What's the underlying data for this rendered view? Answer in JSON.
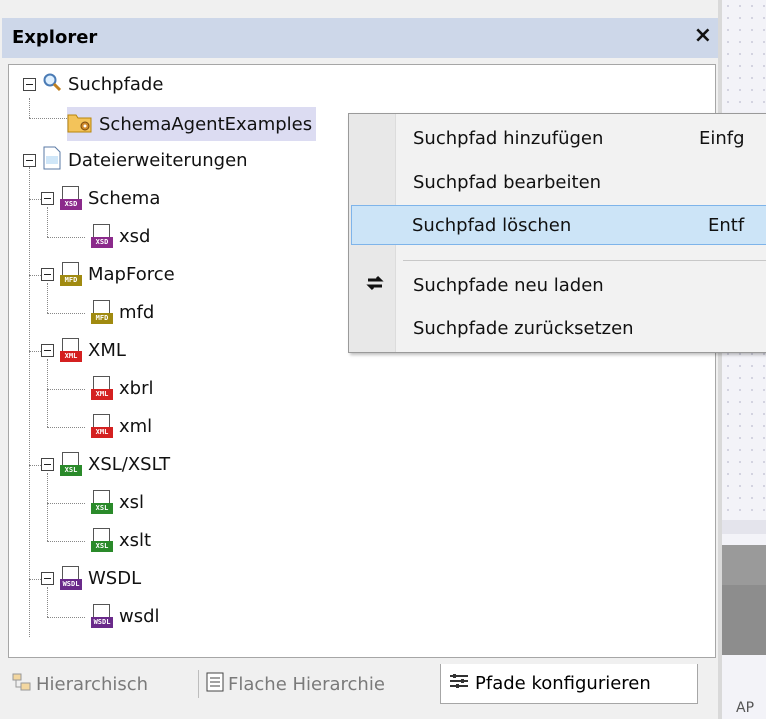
{
  "explorer": {
    "title": "Explorer",
    "close_glyph": "×"
  },
  "tree": {
    "search_paths": "Suchpfade",
    "schema_agent": "SchemaAgentExamples",
    "file_extensions": "Dateierweiterungen",
    "schema": "Schema",
    "xsd": "xsd",
    "mapforce": "MapForce",
    "mfd": "mfd",
    "xml_group": "XML",
    "xbrl": "xbrl",
    "xml": "xml",
    "xsl_group": "XSL/XSLT",
    "xsl": "xsl",
    "xslt": "xslt",
    "wsdl_group": "WSDL",
    "wsdl": "wsdl",
    "icon_tags": {
      "xsd": "XSD",
      "mfd": "MFD",
      "xml": "XML",
      "xsl": "XSL",
      "wsdl": "WSDL"
    }
  },
  "context_menu": {
    "items": [
      {
        "label": "Suchpfad hinzufügen",
        "shortcut": "Einfg"
      },
      {
        "label": "Suchpfad bearbeiten",
        "shortcut": ""
      },
      {
        "label": "Suchpfad löschen",
        "shortcut": "Entf"
      },
      {
        "label": "Suchpfade neu laden",
        "shortcut": ""
      },
      {
        "label": "Suchpfade zurücksetzen",
        "shortcut": ""
      }
    ]
  },
  "tabs": {
    "hierarchical": "Hierarchisch",
    "flat": "Flache Hierarchie",
    "configure": "Pfade konfigurieren"
  },
  "right_panel": {
    "bottom_text": "AP"
  },
  "colors": {
    "xsd": "#8b2a8b",
    "mfd": "#a08a10",
    "xml": "#d42020",
    "xsl": "#2a8a2a",
    "wsdl": "#6a2a8a",
    "highlight": "#cce4f7",
    "selection": "#dcdcf2",
    "titlebar": "#cdd7e9"
  }
}
